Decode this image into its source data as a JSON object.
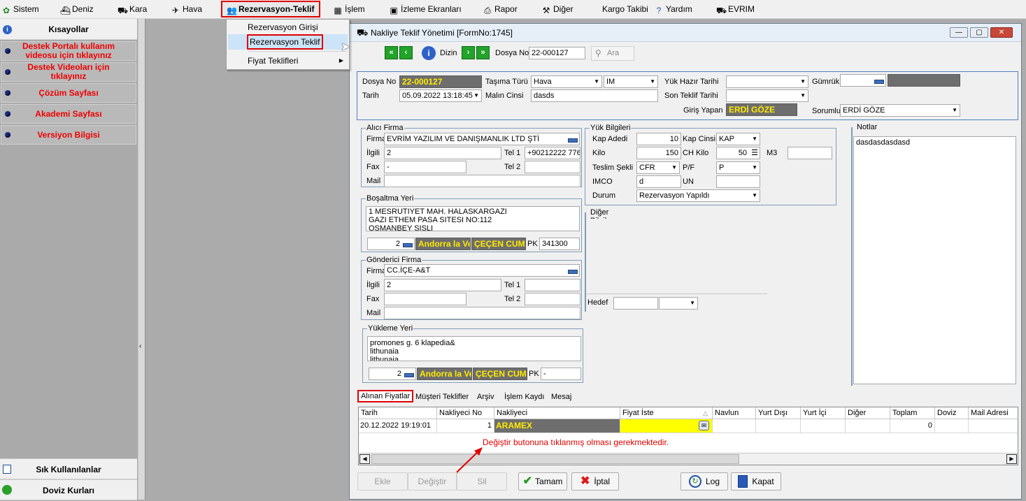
{
  "menubar": {
    "items": [
      "Sistem",
      "Deniz",
      "Kara",
      "Hava",
      "Rezervasyon-Teklif",
      "İşlem",
      "İzleme Ekranları",
      "Rapor",
      "Diğer",
      "Kargo Takibi",
      "Yardım",
      "EVRIM"
    ]
  },
  "dropdown": {
    "items": [
      "Rezervasyon Girişi",
      "Rezervasyon Teklif",
      "Fiyat Teklifleri"
    ]
  },
  "sidebar": {
    "header": "Kısayollar",
    "items": [
      "Destek Portalı kullanım videosu için tıklayınız",
      "Destek Videoları için tıklayınız",
      "Çözüm Sayfası",
      "Akademi Sayfası",
      "Versiyon Bilgisi"
    ],
    "bottom1": "Sık Kullanılanlar",
    "bottom2": "Doviz Kurları"
  },
  "window": {
    "title": "Nakliye Teklif Yönetimi [FormNo:1745]"
  },
  "toolbar": {
    "direction_label": "Dizin",
    "file_label": "Dosya No",
    "file_value": "22-000127",
    "search_label": "Ara"
  },
  "header_form": {
    "dosya_no_label": "Dosya No",
    "dosya_no": "22-000127",
    "tarih_label": "Tarih",
    "tarih": "05.09.2022 13:18:45",
    "tasima_turu_label": "Taşıma Türü",
    "tasima_turu": "Hava",
    "tasima_kod": "IM",
    "malin_cinsi_label": "Malın Cinsi",
    "malin_cinsi": "dasds",
    "yuk_hazir_label": "Yük Hazır Tarihi",
    "son_teklif_label": "Son Teklif Tarihi",
    "giris_yapan_label": "Giriş Yapan",
    "giris_yapan": "ERDİ GÖZE",
    "gumruk_label": "Gümrük",
    "sorumlu_label": "Sorumlu",
    "sorumlu": "ERDİ GÖZE"
  },
  "alici": {
    "title": "Alıcı Firma",
    "firma_label": "Firma",
    "firma": "EVRİM YAZILIM VE DANIŞMANLIK LTD ŞTİ",
    "ilgili_label": "İlgili",
    "ilgili": "2",
    "tel1_label": "Tel 1",
    "tel1": "+90212222 776",
    "fax_label": "Fax",
    "fax": "-",
    "tel2_label": "Tel 2",
    "mail_label": "Mail"
  },
  "bosaltma": {
    "title": "Boşaltma Yeri",
    "address": [
      "1 MESRUTIYET MAH. HALASKARGAZI",
      "GAZI ETHEM PASA SITESI NO:112",
      "OSMANBEY SISLI"
    ],
    "code": "2",
    "country": "Andorra la Ve",
    "city": "ÇEÇEN CUMH",
    "pk_label": "PK",
    "pk": "341300"
  },
  "gonderici": {
    "title": "Gönderici Firma",
    "firma_label": "Firma",
    "firma": "CC.İÇE-A&T",
    "ilgili_label": "İlgili",
    "ilgili": "2",
    "tel1_label": "Tel 1",
    "fax_label": "Fax",
    "tel2_label": "Tel 2",
    "mail_label": "Mail"
  },
  "yukleme": {
    "title": "Yükleme Yeri",
    "address": [
      "promones g. 6 klapedia&",
      "lithunaia",
      "lithunaia"
    ],
    "code": "2",
    "country": "Andorra la Ve",
    "city": "ÇEÇEN CUMH",
    "pk_label": "PK",
    "pk": "-"
  },
  "yuk": {
    "title": "Yük Bilgileri",
    "kap_adedi_label": "Kap Adedi",
    "kap_adedi": "10",
    "kap_cinsi_label": "Kap Cinsi",
    "kap_cinsi": "KAP",
    "kilo_label": "Kilo",
    "kilo": "150",
    "ch_kilo_label": "CH Kilo",
    "ch_kilo": "50",
    "m3_label": "M3",
    "teslim_label": "Teslim Şekli",
    "teslim": "CFR",
    "pf_label": "P/F",
    "pf": "P",
    "imco_label": "IMCO",
    "imco": "d",
    "un_label": "UN",
    "durum_label": "Durum",
    "durum": "Rezervasyon Yapıldı"
  },
  "diger": {
    "title": "Diğer Bilgiler",
    "hedef_label": "Hedef"
  },
  "notlar": {
    "title": "Notlar",
    "text": "dasdasdasdasd"
  },
  "tabs": [
    "Alınan Fiyatlar",
    "Müşteri Teklifler",
    "Arşiv",
    "İşlem Kaydı",
    "Mesaj"
  ],
  "grid": {
    "columns": [
      "Tarih",
      "Nakliyeci No",
      "Nakliyeci",
      "Fiyat İste",
      "Navlun",
      "Yurt Dışı",
      "Yurt İçi",
      "Diğer",
      "Toplam",
      "Doviz",
      "Mail Adresi"
    ],
    "rows": [
      {
        "tarih": "20.12.2022 19:19:01",
        "nakliyeci_no": "1",
        "nakliyeci": "ARAMEX",
        "toplam": "0"
      }
    ]
  },
  "annotation": "Değiştir butonuna tıklanmış olması gerekmektedir.",
  "buttons": {
    "ekle": "Ekle",
    "degistir": "Değiştir",
    "sil": "Sil",
    "tamam": "Tamam",
    "iptal": "İptal",
    "log": "Log",
    "kapat": "Kapat"
  },
  "colors": {
    "highlight_red": "#e00000",
    "dark_field": "#6e6e6e",
    "yellow_text": "#ffea00",
    "nav_green": "#22a32a"
  }
}
